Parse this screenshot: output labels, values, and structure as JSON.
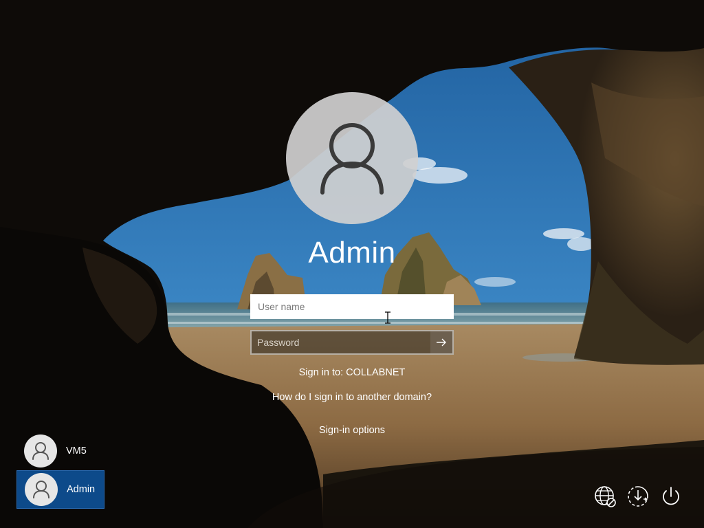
{
  "login": {
    "user_title": "Admin",
    "username_placeholder": "User name",
    "password_placeholder": "Password",
    "sign_in_to": "Sign in to: COLLABNET",
    "another_domain_link": "How do I sign in to another domain?",
    "signin_options_link": "Sign-in options",
    "submit_icon": "arrow-right-icon"
  },
  "users": [
    {
      "name": "VM5",
      "selected": false,
      "icon": "user-icon"
    },
    {
      "name": "Admin",
      "selected": true,
      "icon": "user-icon"
    }
  ],
  "corner_icons": [
    "network-icon",
    "ease-of-access-icon",
    "power-icon"
  ],
  "colors": {
    "selected_tile": "#0d4a8a",
    "avatar_bg": "#d0d0d0",
    "sky": "#2f6fa8",
    "sand": "#b08b5c"
  }
}
